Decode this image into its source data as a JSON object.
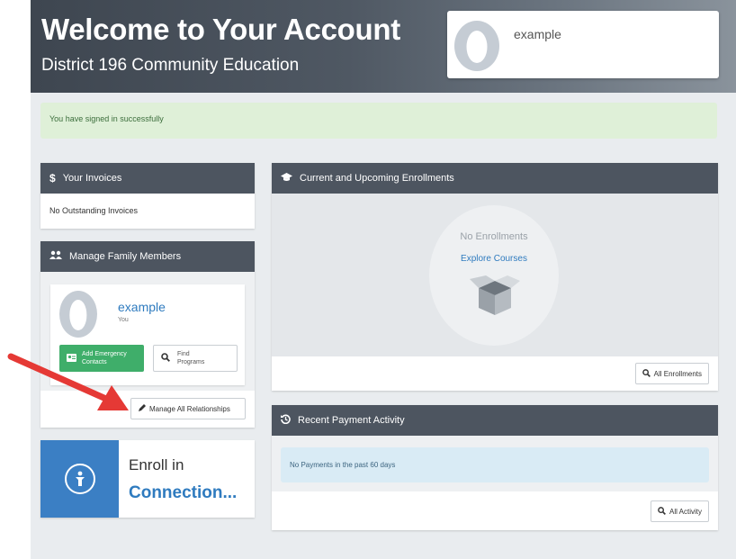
{
  "header": {
    "title": "Welcome to Your Account",
    "subtitle": "District 196 Community Education",
    "profile_name": "example"
  },
  "alert": {
    "text": "You have signed in successfully"
  },
  "invoices": {
    "title": "Your Invoices",
    "icon": "$",
    "body": "No Outstanding Invoices"
  },
  "family": {
    "title": "Manage Family Members",
    "member": {
      "name": "example",
      "role": "You"
    },
    "add_contacts_line1": "Add Emergency",
    "add_contacts_line2": "Contacts",
    "find_line1": "Find",
    "find_line2": "Programs",
    "manage_label": "Manage All Relationships"
  },
  "enroll_card": {
    "line1": "Enroll in",
    "line2": "Connection..."
  },
  "enrollments": {
    "title": "Current and Upcoming Enrollments",
    "empty": "No Enrollments",
    "explore": "Explore Courses",
    "all_label": "All Enrollments"
  },
  "payments": {
    "title": "Recent Payment Activity",
    "empty": "No Payments in the past 60 days",
    "all_label": "All Activity"
  },
  "colors": {
    "header_dark": "#3e4650",
    "panel_head": "#4d5560",
    "success_bg": "#dff0d8",
    "info_bg": "#d9ebf5",
    "link_blue": "#2f7bbf",
    "green_button": "#3fae6a",
    "annotation_arrow": "#e53935"
  }
}
